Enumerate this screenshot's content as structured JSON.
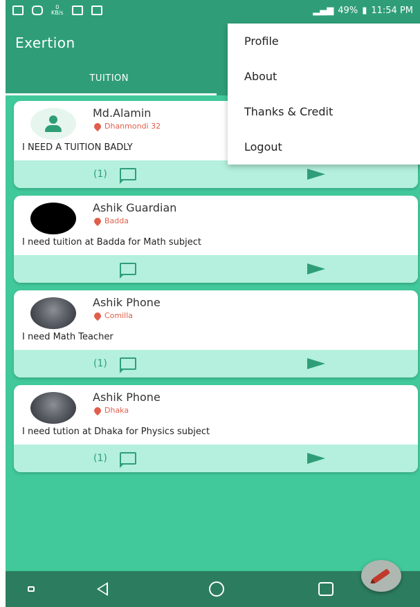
{
  "status_bar": {
    "battery": "49%",
    "time": "11:54 PM",
    "speed_value": "0",
    "speed_unit": "KB/s"
  },
  "app": {
    "title": "Exertion"
  },
  "tabs": [
    {
      "label": "TUITION",
      "selected": true
    }
  ],
  "menu": {
    "items": [
      "Profile",
      "About",
      "Thanks & Credit",
      "Logout"
    ]
  },
  "posts": [
    {
      "name": "Md.Alamin",
      "location": "Dhanmondi 32",
      "text": "I NEED A TUITION BADLY",
      "comment_count": "(1)",
      "avatar": "default"
    },
    {
      "name": "Ashik Guardian",
      "location": "Badda",
      "text": "I need tuition at Badda for Math subject",
      "comment_count": "",
      "avatar": "black"
    },
    {
      "name": "Ashik Phone",
      "location": "Comilla",
      "text": "I need Math Teacher",
      "comment_count": "(1)",
      "avatar": "photo"
    },
    {
      "name": "Ashik Phone",
      "location": "Dhaka",
      "text": "I need tution at Dhaka for Physics subject",
      "comment_count": "(1)",
      "avatar": "photo"
    }
  ],
  "colors": {
    "primary_dark": "#2f9e78",
    "background": "#41c99b",
    "action_bar": "#b4f0dd",
    "location": "#e25e4c"
  },
  "icons": [
    "facebook-icon",
    "instagram-icon",
    "network-speed-icon",
    "gallery-icon",
    "activity-icon",
    "signal-icon",
    "battery-icon",
    "person-icon",
    "location-pin-icon",
    "comment-icon",
    "send-icon",
    "pencil-icon",
    "recent-apps-icon",
    "back-icon",
    "home-icon",
    "overview-icon"
  ]
}
